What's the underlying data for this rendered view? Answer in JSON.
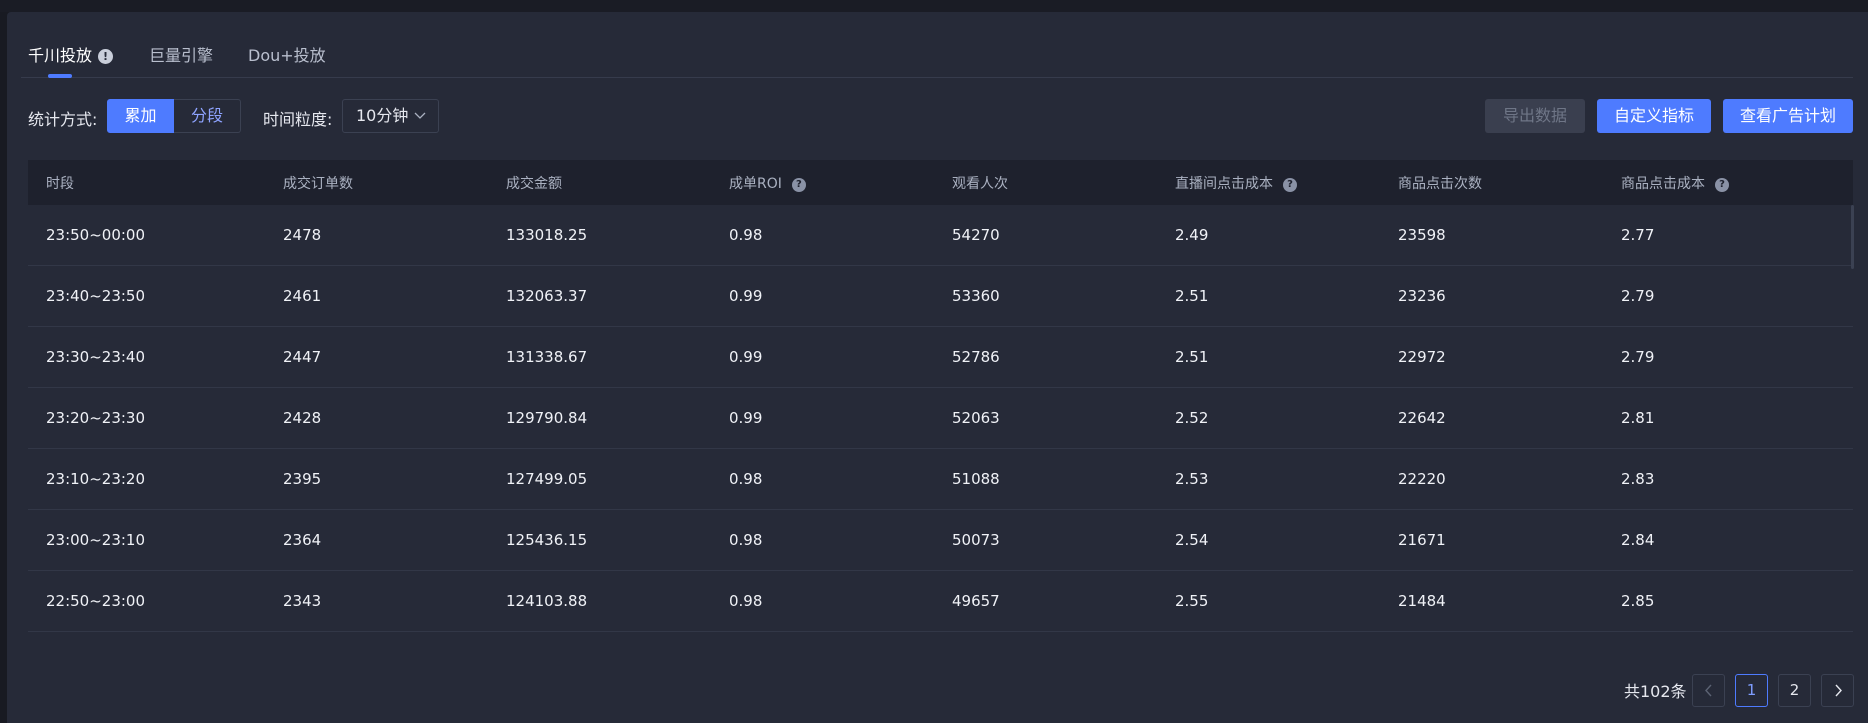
{
  "tabs": [
    {
      "label": "千川投放",
      "active": true
    },
    {
      "label": "巨量引擎",
      "active": false
    },
    {
      "label": "Dou+投放",
      "active": false
    }
  ],
  "toolbar": {
    "stat_mode_label": "统计方式:",
    "stat_mode_options": [
      "累加",
      "分段"
    ],
    "stat_mode_selected": "累加",
    "granularity_label": "时间粒度:",
    "granularity_value": "10分钟",
    "export_label": "导出数据",
    "custom_metrics_label": "自定义指标",
    "view_plan_label": "查看广告计划"
  },
  "table": {
    "columns": [
      "时段",
      "成交订单数",
      "成交金额",
      "成单ROI",
      "观看人次",
      "直播间点击成本",
      "商品点击次数",
      "商品点击成本"
    ],
    "rows": [
      [
        "23:50~00:00",
        "2478",
        "133018.25",
        "0.98",
        "54270",
        "2.49",
        "23598",
        "2.77"
      ],
      [
        "23:40~23:50",
        "2461",
        "132063.37",
        "0.99",
        "53360",
        "2.51",
        "23236",
        "2.79"
      ],
      [
        "23:30~23:40",
        "2447",
        "131338.67",
        "0.99",
        "52786",
        "2.51",
        "22972",
        "2.79"
      ],
      [
        "23:20~23:30",
        "2428",
        "129790.84",
        "0.99",
        "52063",
        "2.52",
        "22642",
        "2.81"
      ],
      [
        "23:10~23:20",
        "2395",
        "127499.05",
        "0.98",
        "51088",
        "2.53",
        "22220",
        "2.83"
      ],
      [
        "23:00~23:10",
        "2364",
        "125436.15",
        "0.98",
        "50073",
        "2.54",
        "21671",
        "2.84"
      ],
      [
        "22:50~23:00",
        "2343",
        "124103.88",
        "0.98",
        "49657",
        "2.55",
        "21484",
        "2.85"
      ]
    ]
  },
  "pagination": {
    "total_label": "共102条",
    "pages": [
      "1",
      "2"
    ],
    "current": "1"
  },
  "colors": {
    "accent": "#4e7bff",
    "background": "#262a38",
    "header_bg": "#1e212d"
  }
}
